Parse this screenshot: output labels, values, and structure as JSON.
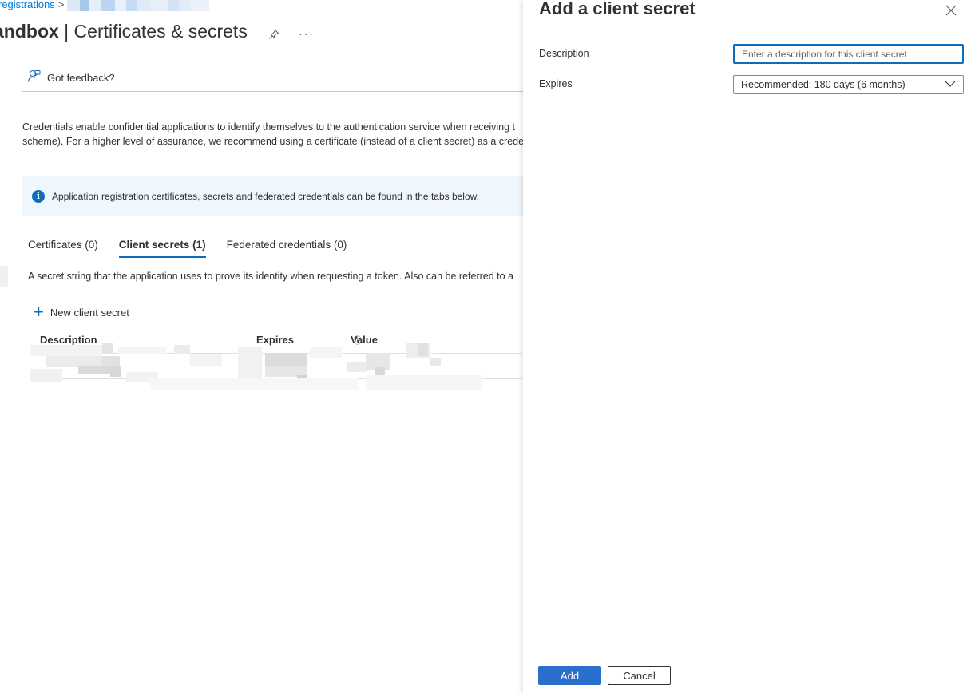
{
  "breadcrumb": {
    "link_label": "registrations",
    "separator": ">"
  },
  "page": {
    "title_bold": "andbox",
    "title_rest": "| Certificates & secrets",
    "pin_icon": "pin-icon",
    "more_label": "···"
  },
  "feedback": {
    "label": "Got feedback?",
    "icon": "feedback-icon"
  },
  "intro": {
    "line1": "Credentials enable confidential applications to identify themselves to the authentication service when receiving t",
    "line2": "scheme). For a higher level of assurance, we recommend using a certificate (instead of a client secret) as a creder"
  },
  "info_bar": {
    "icon_glyph": "i",
    "text": "Application registration certificates, secrets and federated credentials can be found in the tabs below."
  },
  "tabs": [
    {
      "label": "Certificates (0)",
      "active": false
    },
    {
      "label": "Client secrets (1)",
      "active": true
    },
    {
      "label": "Federated credentials (0)",
      "active": false
    }
  ],
  "tab_description": "A secret string that the application uses to prove its identity when requesting a token. Also can be referred to a",
  "new_secret": {
    "plus": "+",
    "label": "New client secret"
  },
  "table": {
    "columns": [
      "Description",
      "Expires",
      "Value"
    ],
    "value_info_icon": "ⓘ"
  },
  "panel": {
    "title": "Add a client secret",
    "close_icon": "close-icon",
    "description_label": "Description",
    "description_placeholder": "Enter a description for this client secret",
    "description_value": "",
    "expires_label": "Expires",
    "expires_selected": "Recommended: 180 days (6 months)",
    "add_label": "Add",
    "cancel_label": "Cancel"
  },
  "colors": {
    "accent": "#0f6cbd",
    "link": "#0078d4",
    "add_button": "#2b6fce",
    "info_bar_bg": "#eff6fc"
  }
}
